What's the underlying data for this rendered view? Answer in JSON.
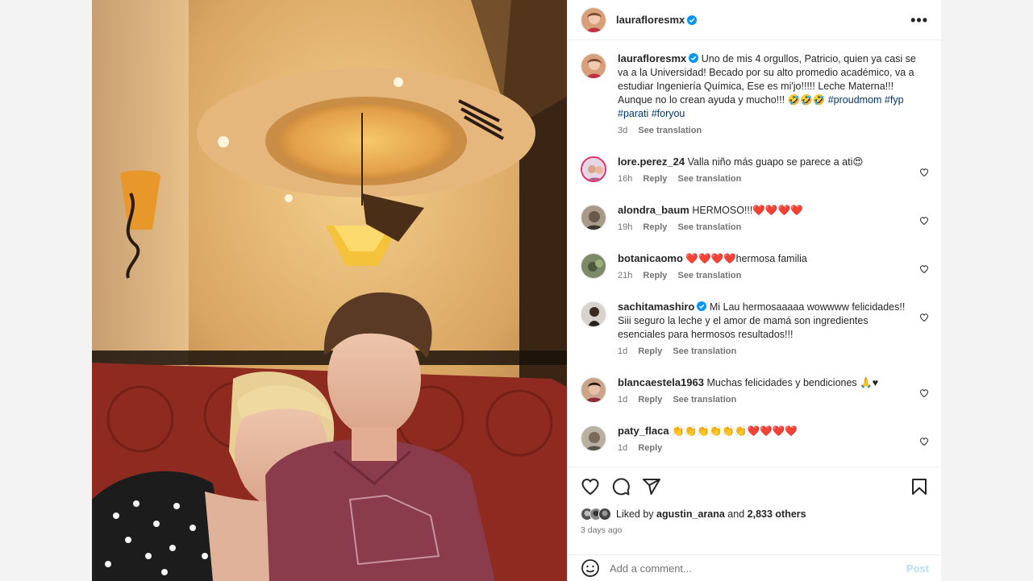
{
  "colors": {
    "accent": "#0095f6",
    "link": "#00376b",
    "heart": "#e0245e"
  },
  "post": {
    "author": "laurafloresmx",
    "more_icon": "•••",
    "caption": {
      "text": "Uno de mis 4 orgullos, Patricio, quien ya casi se va a la Universidad! Becado por su alto promedio académico, va a estudiar Ingeniería Química, Ese es mi'jo!!!!! Leche Materna!!! Aunque no lo crean ayuda y mucho!!! 🤣🤣🤣",
      "hashtags": "#proudmom #fyp #parati #foryou",
      "time": "3d",
      "see_translation": "See translation"
    }
  },
  "comments": [
    {
      "username": "lore.perez_24",
      "text": "Valla niño más guapo se parece a ati😍",
      "time": "16h",
      "reply": "Reply",
      "see_translation": "See translation"
    },
    {
      "username": "alondra_baum",
      "text": "HERMOSO!!!❤️❤️❤️❤️",
      "time": "19h",
      "reply": "Reply",
      "see_translation": "See translation"
    },
    {
      "username": "botanicaomo",
      "text": "❤️❤️❤️❤️hermosa familia",
      "time": "21h",
      "reply": "Reply",
      "see_translation": "See translation"
    },
    {
      "username": "sachitamashiro",
      "text": "Mi Lau hermosaaaaa wowwww felicidades!! Siii seguro la leche y el amor de mamá son ingredientes esenciales para hermosos resultados!!!",
      "time": "1d",
      "reply": "Reply",
      "see_translation": "See translation"
    },
    {
      "username": "blancaestela1963",
      "text": "Muchas felicidades y bendiciones 🙏♥",
      "time": "1d",
      "reply": "Reply",
      "see_translation": "See translation"
    },
    {
      "username": "paty_flaca",
      "text": "👏👏👏👏👏👏❤️❤️❤️❤️",
      "time": "1d",
      "reply": "Reply"
    }
  ],
  "likes": {
    "prefix": "Liked by",
    "user": "agustin_arana",
    "joiner": "and",
    "others": "2,833 others"
  },
  "date": "3 days ago",
  "add_comment": {
    "placeholder": "Add a comment...",
    "post_label": "Post"
  }
}
